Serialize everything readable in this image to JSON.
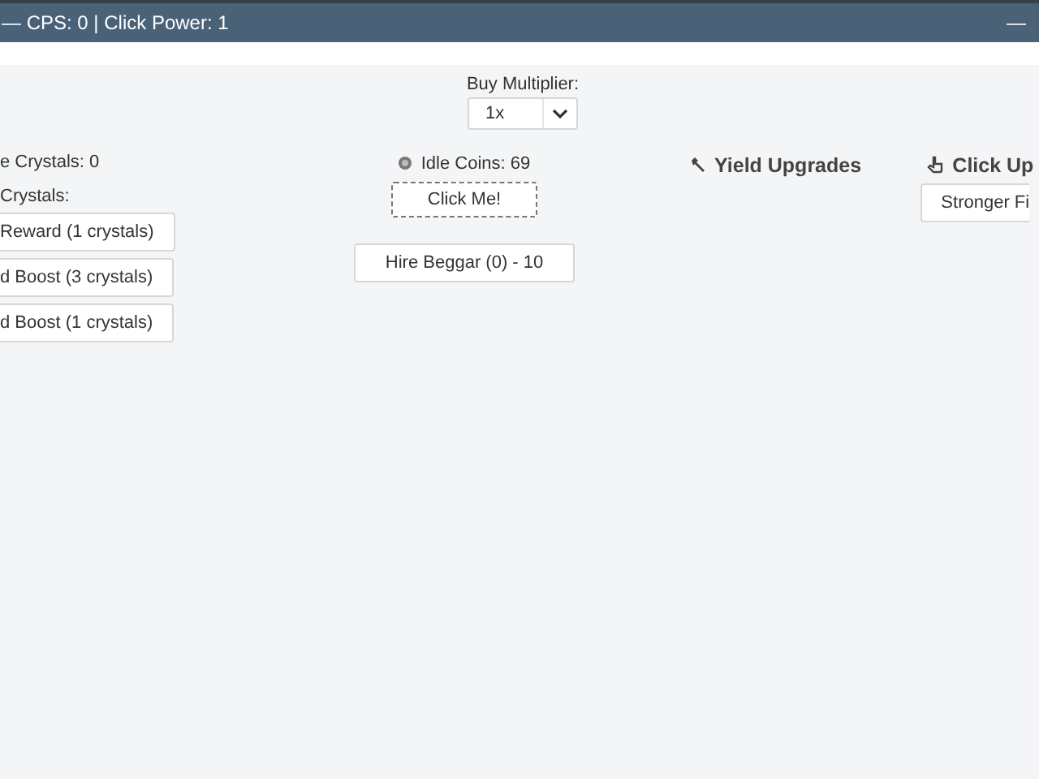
{
  "window": {
    "title": "— CPS: 0 | Click Power: 1",
    "minimize": "—"
  },
  "multiplier": {
    "label": "Buy Multiplier:",
    "value": "1x"
  },
  "crystals": {
    "count": "e Crystals: 0",
    "heading": "Crystals:",
    "buttons": [
      "Reward (1 crystals)",
      "d Boost (3 crystals)",
      "d Boost (1 crystals)"
    ]
  },
  "coins": {
    "label": "Idle Coins: 69",
    "click_button": {
      "label": "Click Me!",
      "focused": true
    },
    "hire_buttons": [
      "Hire Beggar (0) - 10"
    ]
  },
  "sections": [
    {
      "title": "Yield Upgrades",
      "kind": "wrench"
    },
    {
      "title": "Click Up",
      "kind": "hand",
      "buttons": [
        "Stronger Fi"
      ]
    }
  ]
}
